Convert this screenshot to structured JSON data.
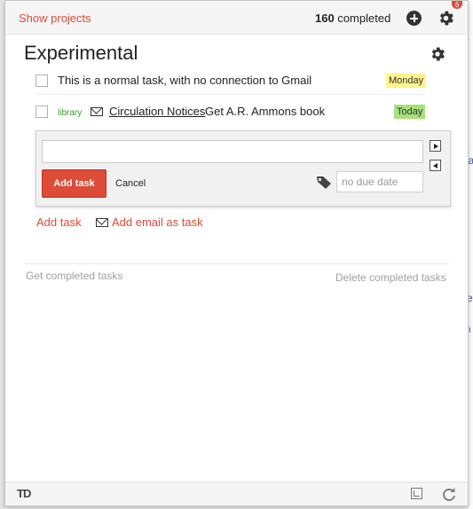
{
  "header": {
    "show_projects": "Show projects",
    "completed_count": "160",
    "completed_label": "completed",
    "notification_badge": "6"
  },
  "list": {
    "title": "Experimental",
    "tasks": [
      {
        "text": "This is a normal task, with no connection to Gmail",
        "due": "Monday",
        "due_color": "#fff48c"
      },
      {
        "tag": "library",
        "link": "Circulation Notices",
        "text": "Get A.R. Ammons book",
        "due": "Today",
        "due_color": "#a6e27c"
      }
    ]
  },
  "add_panel": {
    "task_input_value": "",
    "add_button": "Add task",
    "cancel": "Cancel",
    "due_placeholder": "no due date"
  },
  "actions": {
    "add_task": "Add task",
    "add_email_as_task": "Add email as task",
    "get_completed": "Get completed tasks",
    "delete_completed": "Delete completed tasks"
  },
  "footer": {
    "logo": "TD"
  },
  "background_fragments": [
    "la",
    "e",
    "fi"
  ],
  "colors": {
    "accent": "#dd4b39",
    "tag_green": "#3a9a2c"
  }
}
